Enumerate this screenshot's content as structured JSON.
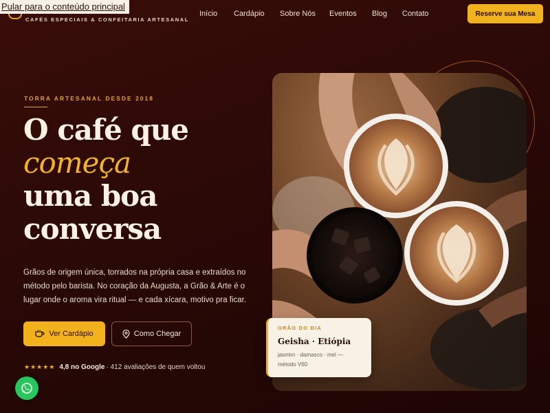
{
  "skip_link": "Pular para o conteúdo principal",
  "brand": {
    "tagline": "CAFÉS ESPECIAIS & CONFEITARIA ARTESANAL"
  },
  "nav": {
    "items": [
      "Início",
      "Cardápio",
      "Sobre Nós",
      "Eventos",
      "Blog",
      "Contato"
    ]
  },
  "header": {
    "reserve_label": "Reserve sua Mesa"
  },
  "hero": {
    "eyebrow": "TORRA ARTESANAL DESDE 2018",
    "headline_1": "O café que",
    "headline_accent": "começa",
    "headline_3": "uma boa",
    "headline_4": "conversa",
    "lead": "Grãos de origem única, torrados na própria casa e extraídos no método pelo barista. No coração da Augusta, a Grão & Arte é o lugar onde o aroma vira ritual — e cada xícara, motivo pra ficar.",
    "primary_cta": "Ver Cardápio",
    "secondary_cta": "Como Chegar"
  },
  "rating": {
    "stars": "★★★★★",
    "score": "4,8 no Google",
    "reviews": "· 412 avaliações de quem voltou"
  },
  "daily_card": {
    "label": "GRÃO DO DIA",
    "name": "Geisha · Etiópia",
    "notes": "jasmim · damasco · mel — método V60"
  },
  "colors": {
    "accent": "#f2b21e",
    "background": "#2a0906",
    "whatsapp": "#27c75d"
  },
  "icons": {
    "brand": "coffee-cup-icon",
    "primary_cta": "coffee-cup-icon",
    "secondary_cta": "map-pin-icon",
    "whatsapp": "whatsapp-icon"
  }
}
